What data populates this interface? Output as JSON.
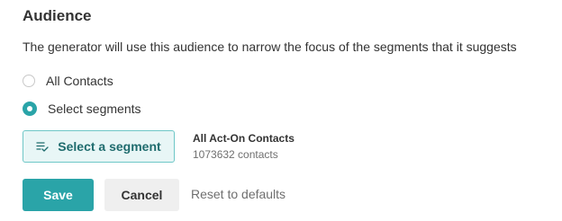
{
  "section": {
    "title": "Audience",
    "description": "The generator will use this audience to narrow the focus of the segments that it suggests"
  },
  "audience_options": [
    {
      "label": "All Contacts",
      "selected": false
    },
    {
      "label": "Select segments",
      "selected": true
    }
  ],
  "segment_picker": {
    "button_label": "Select a segment",
    "button_icon": "list-check-icon",
    "selected_name": "All Act-On Contacts",
    "selected_count": "1073632 contacts"
  },
  "actions": {
    "save_label": "Save",
    "cancel_label": "Cancel",
    "reset_label": "Reset to defaults"
  },
  "colors": {
    "accent": "#2aa4a8",
    "accent_light": "#e8f6f6",
    "accent_text": "#1f6c6e"
  }
}
